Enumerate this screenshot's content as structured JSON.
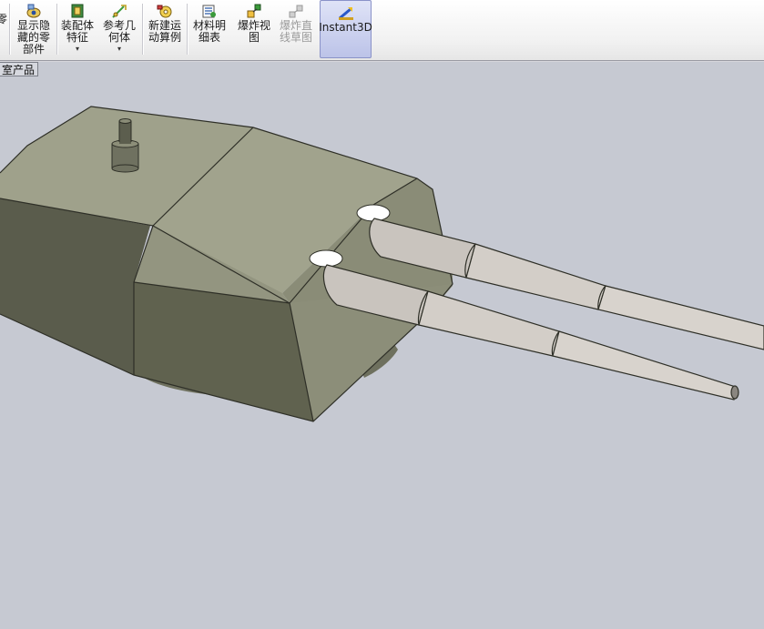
{
  "toolbar": {
    "items": [
      {
        "label": "零",
        "icon": "part-icon"
      },
      {
        "label": "显示隐\n藏的零\n部件",
        "icon": "show-hidden-components-icon"
      },
      {
        "label": "装配体\n特征",
        "icon": "assembly-feature-icon",
        "dropdown": "▾"
      },
      {
        "label": "参考几\n何体",
        "icon": "reference-geometry-icon",
        "dropdown": "▾"
      },
      {
        "label": "新建运\n动算例",
        "icon": "motion-study-icon"
      },
      {
        "label": "材料明\n细表",
        "icon": "bill-of-materials-icon"
      },
      {
        "label": "爆炸视\n图",
        "icon": "exploded-view-icon"
      },
      {
        "label": "爆炸直\n线草图",
        "icon": "explode-line-sketch-icon"
      },
      {
        "label": "Instant3D",
        "icon": "instant3d-icon"
      }
    ]
  },
  "tree_tab": {
    "label": "室产品"
  },
  "colors": {
    "background": "#c6c9d2",
    "turret_light": "#9ea089",
    "turret_mid": "#8d8f79",
    "turret_dark": "#5c5e4e",
    "barrel": "#cfcac4",
    "active_button": "#bcc3e8"
  }
}
